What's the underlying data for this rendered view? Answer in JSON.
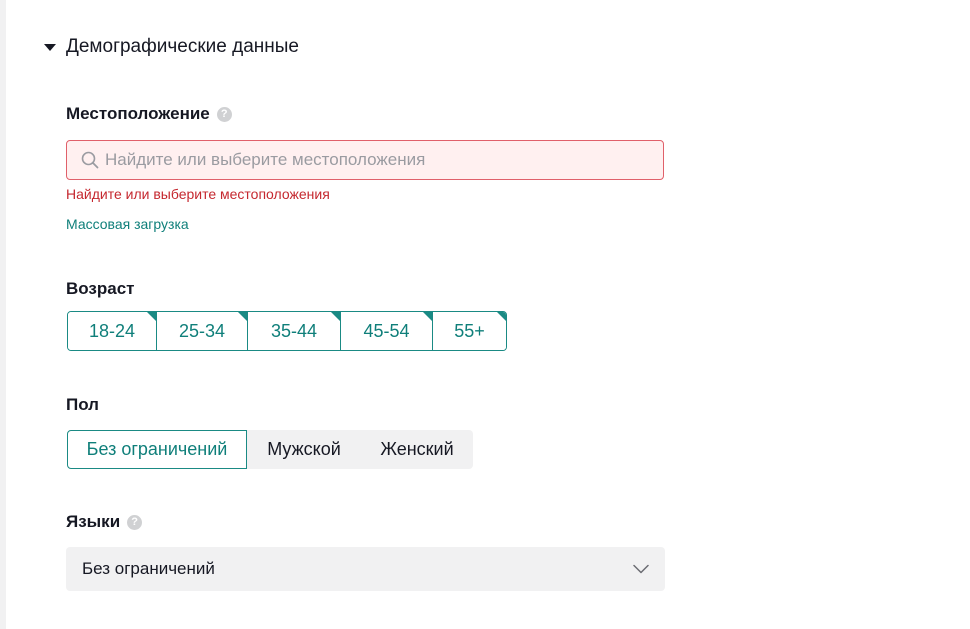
{
  "section": {
    "title": "Демографические данные"
  },
  "location": {
    "label": "Местоположение",
    "help_icon": "question-circle-icon",
    "placeholder": "Найдите или выберите местоположения",
    "value": "",
    "error": "Найдите или выберите местоположения",
    "bulk_upload": "Массовая загрузка"
  },
  "age": {
    "label": "Возраст",
    "options": [
      "18-24",
      "25-34",
      "35-44",
      "45-54",
      "55+"
    ],
    "all_selected": true
  },
  "gender": {
    "label": "Пол",
    "options": [
      "Без ограничений",
      "Мужской",
      "Женский"
    ],
    "selected": "Без ограничений"
  },
  "languages": {
    "label": "Языки",
    "help_icon": "question-circle-icon",
    "value": "Без ограничений"
  },
  "colors": {
    "accent": "#1a8a84",
    "error": "#c5282f",
    "error_bg": "#fff0f0",
    "neutral_bg": "#f1f1f2"
  }
}
